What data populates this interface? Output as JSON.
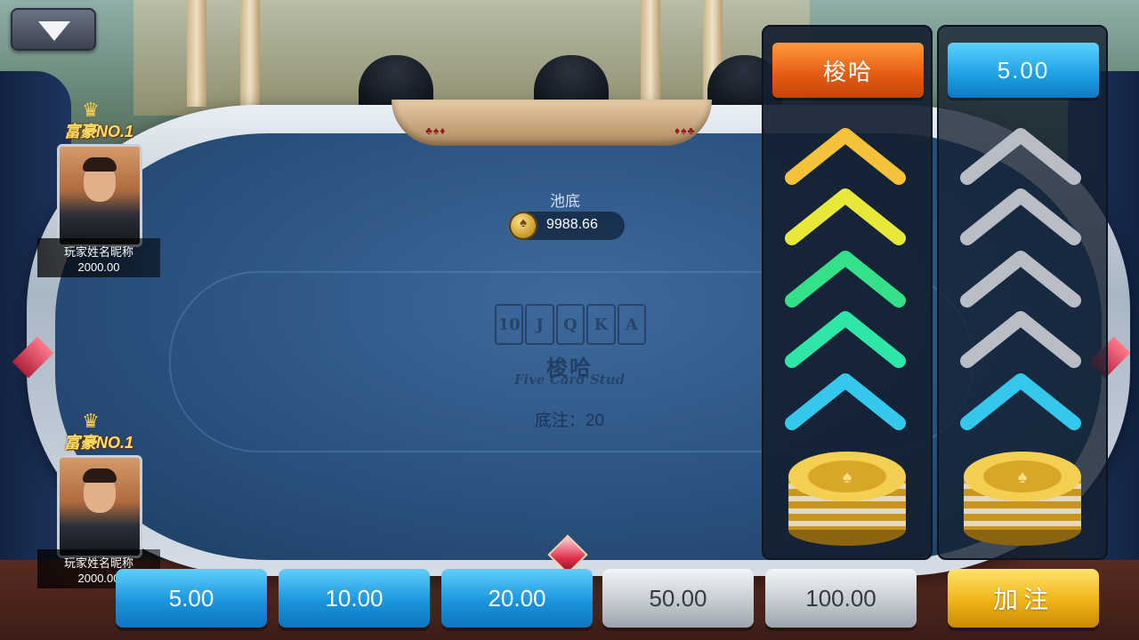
{
  "game": {
    "pot_label": "池底",
    "pot_amount": "9988.66",
    "logo_cards": [
      "10",
      "J",
      "Q",
      "K",
      "A"
    ],
    "logo_cn": "梭哈",
    "logo_en": "Five Card Stud",
    "base_bet": "底注：20"
  },
  "players": [
    {
      "title": "富豪NO.1",
      "name": "玩家姓名昵称",
      "score": "2000.00"
    },
    {
      "title": "富豪NO.1",
      "name": "玩家姓名昵称",
      "score": "2000.00"
    }
  ],
  "panels": {
    "allin_label": "梭哈",
    "raise_value": "5.00",
    "left_colors": [
      "#f6c23a",
      "#e8e83a",
      "#35e08a",
      "#2ee6a6",
      "#34c8ec"
    ],
    "right_colors": [
      "#b9bec6",
      "#b9bec6",
      "#b9bec6",
      "#b9bec6",
      "#34c8ec"
    ]
  },
  "bets": [
    {
      "label": "5.00",
      "active": true
    },
    {
      "label": "10.00",
      "active": true
    },
    {
      "label": "20.00",
      "active": true
    },
    {
      "label": "50.00",
      "active": false
    },
    {
      "label": "100.00",
      "active": false
    }
  ],
  "raise_button": "加注",
  "colors": {
    "accent_blue": "#1a95de",
    "accent_orange": "#e45a12",
    "accent_gold": "#f0b416"
  }
}
